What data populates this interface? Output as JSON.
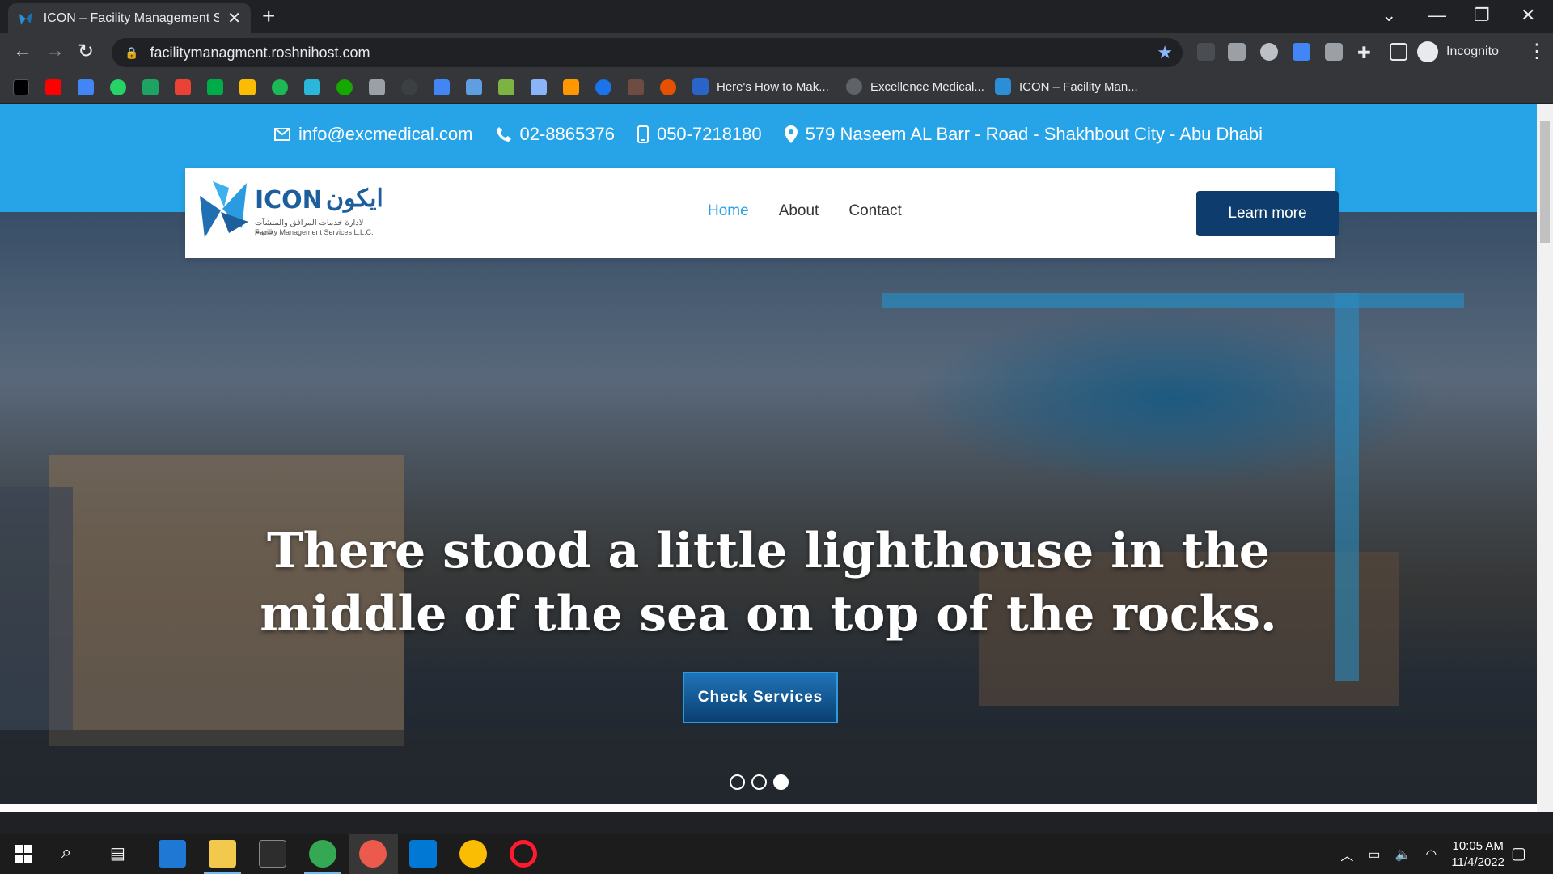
{
  "browser": {
    "tab_title": "ICON – Facility Management Ser",
    "url": "facilitymanagment.roshnihost.com",
    "profile_label": "Incognito",
    "bookmarks": [
      {
        "label": "Here's How to Mak...",
        "icon": "vs-icon"
      },
      {
        "label": "Excellence Medical...",
        "icon": "globe-icon"
      },
      {
        "label": "ICON – Facility Man...",
        "icon": "icon-logo-icon"
      }
    ]
  },
  "site": {
    "contact": {
      "email": "info@excmedical.com",
      "phone": "02-8865376",
      "mobile": "050-7218180",
      "address": "579 Naseem AL Barr - Road - Shakhbout City - Abu Dhabi"
    },
    "logo": {
      "en": "ICON",
      "ar": "ايكون",
      "sub_ar": "لادارة خدمات المرافق والمنشآت ذ.م.م",
      "sub_en": "Facility Management Services L.L.C."
    },
    "nav": {
      "home": "Home",
      "about": "About",
      "contact": "Contact",
      "cta": "Learn more"
    },
    "hero": {
      "title_line1": "There stood a little lighthouse in the",
      "title_line2": "middle of the sea on top of the rocks.",
      "button": "Check Services",
      "slides_total": 3,
      "slide_active": 3
    }
  },
  "taskbar": {
    "time": "10:05 AM",
    "date": "11/4/2022"
  },
  "colors": {
    "topbar": "#27a4e7",
    "nav_active": "#27a4e7",
    "cta": "#0e3d6d"
  }
}
